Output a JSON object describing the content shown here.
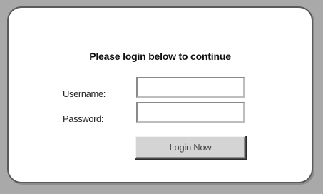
{
  "login": {
    "title": "Please login below to continue",
    "username_label": "Username:",
    "password_label": "Password:",
    "username_value": "",
    "password_value": "",
    "submit_label": "Login Now"
  },
  "colors": {
    "page_background": "#a9a9a9",
    "panel_background": "#ffffff",
    "button_background": "#d4d4d4"
  }
}
